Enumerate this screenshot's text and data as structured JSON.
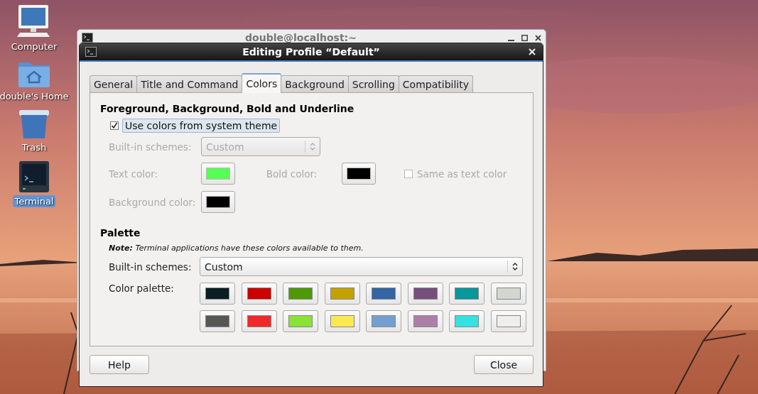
{
  "desktop_icons": [
    {
      "kind": "computer",
      "label": "Computer",
      "selected": false
    },
    {
      "kind": "home",
      "label": "double's Home",
      "selected": false
    },
    {
      "kind": "trash",
      "label": "Trash",
      "selected": false
    },
    {
      "kind": "terminal",
      "label": "Terminal",
      "selected": true
    }
  ],
  "background_window": {
    "title": "double@localhost:~"
  },
  "dialog": {
    "title": "Editing Profile “Default”",
    "tabs": [
      {
        "label": "General",
        "selected": false
      },
      {
        "label": "Title and Command",
        "selected": false
      },
      {
        "label": "Colors",
        "selected": true
      },
      {
        "label": "Background",
        "selected": false
      },
      {
        "label": "Scrolling",
        "selected": false
      },
      {
        "label": "Compatibility",
        "selected": false
      }
    ],
    "foreground_section": {
      "heading": "Foreground, Background, Bold and Underline",
      "use_system_colors": {
        "label": "Use colors from system theme",
        "checked": true
      },
      "disabled": true,
      "builtin_schemes": {
        "label": "Built-in schemes:",
        "value": "Custom"
      },
      "text_color": {
        "label": "Text color:",
        "color": "#55ff55"
      },
      "bold_color": {
        "label": "Bold color:",
        "color": "#000000"
      },
      "same_as_text_color": {
        "label": "Same as text color",
        "checked": false
      },
      "background_color": {
        "label": "Background color:",
        "color": "#000000"
      }
    },
    "palette_section": {
      "heading": "Palette",
      "note": "**Note:** Terminal applications have these colors available to them.",
      "builtin_schemes": {
        "label": "Built-in schemes:",
        "value": "Custom"
      },
      "color_palette": {
        "label": "Color palette:",
        "colors": [
          {
            "color": "#0b1e24"
          },
          {
            "color": "#cc0000"
          },
          {
            "color": "#4e9a06"
          },
          {
            "color": "#c4a000"
          },
          {
            "color": "#3465a4"
          },
          {
            "color": "#75507b"
          },
          {
            "color": "#06989a"
          },
          {
            "color": "#d3d7cf"
          },
          {
            "color": "#555753"
          },
          {
            "color": "#ef2929"
          },
          {
            "color": "#8ae234"
          },
          {
            "color": "#fce94f"
          },
          {
            "color": "#729fcf"
          },
          {
            "color": "#ad7fa8"
          },
          {
            "color": "#34e2e2"
          },
          {
            "color": "#eeeeec"
          }
        ]
      }
    },
    "buttons": [
      {
        "label": "Help"
      },
      {
        "label": "Close"
      }
    ]
  }
}
